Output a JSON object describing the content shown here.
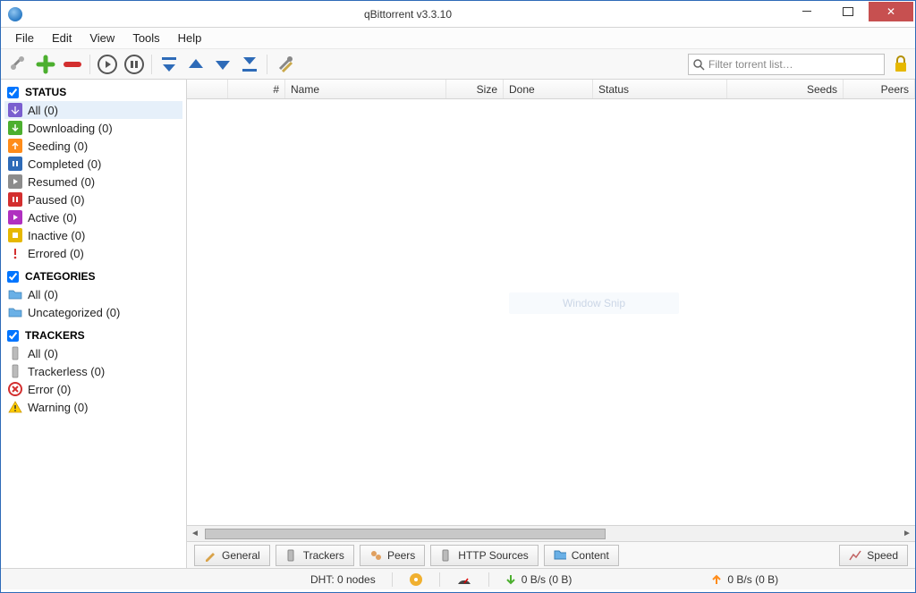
{
  "window": {
    "title": "qBittorrent v3.3.10"
  },
  "menu": {
    "file": "File",
    "edit": "Edit",
    "view": "View",
    "tools": "Tools",
    "help": "Help"
  },
  "toolbar": {
    "search_placeholder": "Filter torrent list…"
  },
  "sidebar": {
    "status_header": "STATUS",
    "categories_header": "CATEGORIES",
    "trackers_header": "TRACKERS",
    "status": {
      "all": "All (0)",
      "downloading": "Downloading (0)",
      "seeding": "Seeding (0)",
      "completed": "Completed (0)",
      "resumed": "Resumed (0)",
      "paused": "Paused (0)",
      "active": "Active (0)",
      "inactive": "Inactive (0)",
      "errored": "Errored (0)"
    },
    "categories": {
      "all": "All (0)",
      "uncategorized": "Uncategorized (0)"
    },
    "trackers": {
      "all": "All (0)",
      "trackerless": "Trackerless (0)",
      "error": "Error (0)",
      "warning": "Warning (0)"
    }
  },
  "columns": {
    "num": "#",
    "name": "Name",
    "size": "Size",
    "done": "Done",
    "status": "Status",
    "seeds": "Seeds",
    "peers": "Peers"
  },
  "watermark": "Window Snip",
  "tabs": {
    "general": "General",
    "trackers": "Trackers",
    "peers": "Peers",
    "http": "HTTP Sources",
    "content": "Content",
    "speed": "Speed"
  },
  "status_bar": {
    "dht": "DHT: 0 nodes",
    "down": "0 B/s (0 B)",
    "up": "0 B/s (0 B)"
  }
}
